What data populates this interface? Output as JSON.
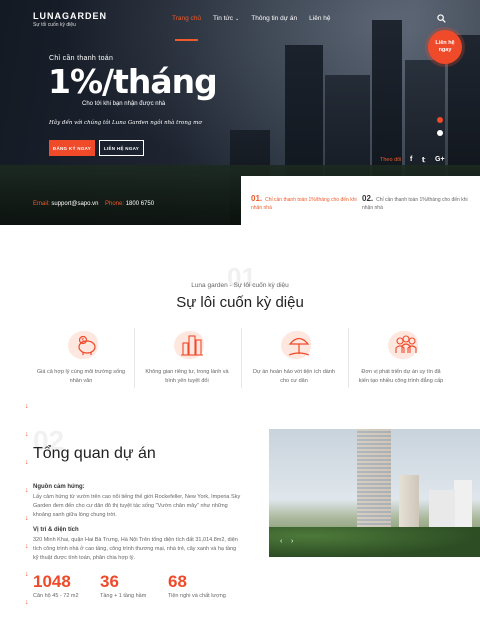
{
  "brand": {
    "logo_prefix": "LUNA",
    "logo_suffix": "GARDEN",
    "tagline": "Sự tối cuốn kỳ diệu"
  },
  "nav": {
    "items": [
      {
        "label": "Trang chủ",
        "active": true
      },
      {
        "label": "Tin tức",
        "has_dropdown": true
      },
      {
        "label": "Thông tin dự án"
      },
      {
        "label": "Liên hệ"
      }
    ],
    "search_icon": "search-icon"
  },
  "contact_circle": {
    "line1": "Liên hệ",
    "line2": "ngay"
  },
  "hero": {
    "small": "Chỉ cần thanh toán",
    "big": "1%/tháng",
    "mid": "Cho tới khi bạn nhận được nhà",
    "script": "Hãy đến với chúng tôi Luna Garden ngôi nhà trong mơ",
    "btn_register": "ĐĂNG KÝ NGAY",
    "btn_contact": "LIÊN HỆ NGAY",
    "follow": "Theo dõi",
    "social": {
      "facebook": "f",
      "twitter": "𝕥",
      "google": "G+"
    },
    "email_label": "Email:",
    "email": "support@sapo.vn",
    "phone_label": "Phone:",
    "phone": "1800 6750"
  },
  "hero_panel": [
    {
      "num": "01.",
      "text": "Chỉ cần thanh toán 1%/tháng cho đến khi nhận nhà"
    },
    {
      "num": "02.",
      "text": "Chỉ cần thanh toán 1%/tháng cho đến khi nhận nhà"
    }
  ],
  "section1": {
    "bignum": "01",
    "sub": "Luna garden - Sự lôi cuốn kỳ diệu",
    "title": "Sự lôi cuốn kỳ diệu",
    "features": [
      {
        "icon": "piggy-bank-icon",
        "line1": "Giá cả hợp lý cùng môi trường sống",
        "line2": "nhân văn"
      },
      {
        "icon": "city-buildings-icon",
        "line1": "Không gian riêng tư, trong lành và",
        "line2": "bình yên tuyệt đối"
      },
      {
        "icon": "beach-umbrella-icon",
        "line1": "Dự án hoàn hảo với tiện ích dành",
        "line2": "cho cư dân"
      },
      {
        "icon": "people-group-icon",
        "line1": "Đơn vị phát triển dự án uy tín đã",
        "line2": "kiến tạo nhiều công trình đẳng cấp"
      }
    ]
  },
  "section2": {
    "bignum": "02",
    "title": "Tổng quan dự án",
    "inspiration_heading": "Nguồn cảm hứng:",
    "inspiration_lines": [
      "Lấy cảm hứng từ vườn trên cao nổi tiếng thế giới Rockefeller, New York, Imperia Sky",
      "Garden đem đến cho cư dân đô thị tuyệt tác sống \"Vườn chân mây\" như những",
      "khoảng xanh giữa lòng chung trời."
    ],
    "location_heading": "Vị trí & diện tích",
    "location_lines": [
      "320 Minh Khai, quận Hai Bà Trưng, Hà Nội Trên tổng diện tích đất 31,014.8m2, diện",
      "tích công trình nhà ở cao tầng, công trình thương mại, nhà trẻ, cây xanh và hạ tầng",
      "kỹ thuật được tính toán, phân chia hợp lý."
    ],
    "stats": [
      {
        "value": "1048",
        "label": "Căn hộ 45 - 72 m2"
      },
      {
        "value": "36",
        "label": "Tầng + 1 tầng hầm"
      },
      {
        "value": "68",
        "label": "Tiện nghi và chất lượng"
      }
    ],
    "photo_prev": "‹",
    "photo_next": "›"
  }
}
